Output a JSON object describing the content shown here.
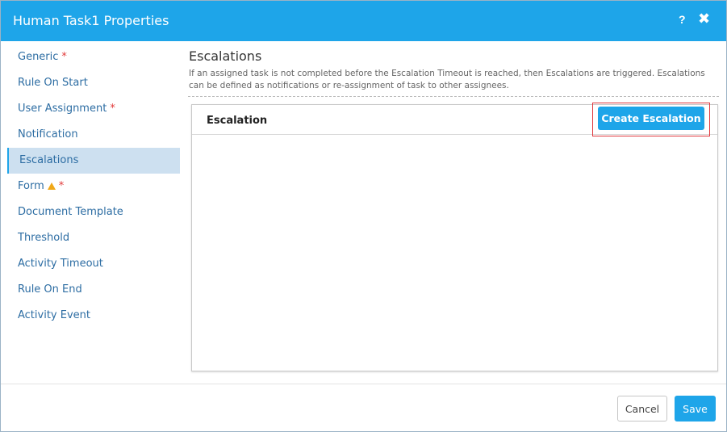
{
  "window": {
    "title": "Human Task1 Properties",
    "help_label": "?",
    "close_label": "✖"
  },
  "sidebar": {
    "items": [
      {
        "label": "Generic",
        "required": "*"
      },
      {
        "label": "Rule On Start"
      },
      {
        "label": "User Assignment",
        "required": "*"
      },
      {
        "label": "Notification"
      },
      {
        "label": "Escalations",
        "active": true
      },
      {
        "label": "Form",
        "warning": "warning-icon",
        "required": "*"
      },
      {
        "label": "Document Template"
      },
      {
        "label": "Threshold"
      },
      {
        "label": "Activity Timeout"
      },
      {
        "label": "Rule On End"
      },
      {
        "label": "Activity Event"
      }
    ]
  },
  "main": {
    "title": "Escalations",
    "description": "If an assigned task is not completed before the Escalation Timeout is reached, then Escalations are triggered. Escalations can be defined as notifications or re-assignment of task to other assignees.",
    "panel": {
      "header": "Escalation",
      "create_button": "Create Escalation"
    }
  },
  "footer": {
    "cancel_label": "Cancel",
    "save_label": "Save"
  },
  "colors": {
    "accent": "#1ea5e9",
    "active_nav_bg": "#cde0f0",
    "required": "#e23b3b",
    "warning": "#f0a818",
    "highlight": "#e0393e"
  }
}
